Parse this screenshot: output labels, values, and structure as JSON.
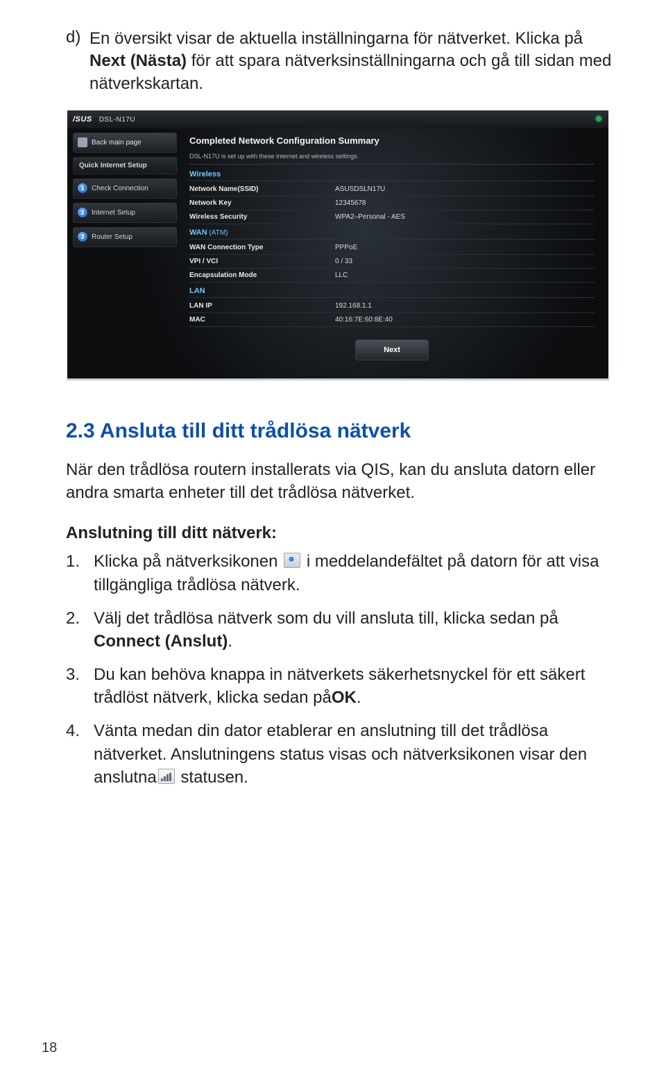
{
  "intro": {
    "marker": "d)",
    "text_pre": "En översikt visar de aktuella inställningarna för nätverket. Klicka på ",
    "text_bold": "Next (Nästa)",
    "text_post": " för att spara nätverksinställningarna och gå till sidan med nätverkskartan."
  },
  "screenshot": {
    "brand": "/SUS",
    "model": "DSL-N17U",
    "sidebar": {
      "back": "Back main page",
      "heading": "Quick Internet Setup",
      "items": [
        {
          "num": "1",
          "label": "Check Connection"
        },
        {
          "num": "2",
          "label": "Internet Setup"
        },
        {
          "num": "3",
          "label": "Router Setup"
        }
      ]
    },
    "main": {
      "title": "Completed Network Configuration Summary",
      "note": "DSL-N17U is set up with these Internet and wireless settings.",
      "sections": [
        {
          "name": "Wireless",
          "annotation": "",
          "rows": [
            {
              "k": "Network Name(SSID)",
              "v": "ASUSDSLN17U"
            },
            {
              "k": "Network Key",
              "v": "12345678"
            },
            {
              "k": "Wireless Security",
              "v": "WPA2–Personal - AES"
            }
          ]
        },
        {
          "name": "WAN",
          "annotation": " (ATM)",
          "rows": [
            {
              "k": "WAN Connection Type",
              "v": "PPPoE"
            },
            {
              "k": "VPI / VCI",
              "v": "0 / 33"
            },
            {
              "k": "Encapsulation Mode",
              "v": "LLC"
            }
          ]
        },
        {
          "name": "LAN",
          "annotation": "",
          "rows": [
            {
              "k": "LAN IP",
              "v": "192.168.1.1"
            },
            {
              "k": "MAC",
              "v": "40:16:7E:60:8E:40"
            }
          ]
        }
      ],
      "next_label": "Next"
    }
  },
  "section": {
    "heading": "2.3  Ansluta till ditt trådlösa nätverk",
    "para": "När den trådlösa routern installerats via QIS, kan du ansluta datorn eller andra smarta enheter till det trådlösa nätverket.",
    "subhead": "Anslutning till ditt nätverk:",
    "steps": {
      "s1_pre": "Klicka på nätverksikonen ",
      "s1_post": " i meddelandefältet på datorn för att visa tillgängliga trådlösa nätverk.",
      "s2_pre": "Välj det trådlösa nätverk som du vill ansluta till, klicka sedan på ",
      "s2_bold": "Connect (Anslut)",
      "s2_post": ".",
      "s3_pre": "Du kan behöva knappa in nätverkets säkerhetsnyckel för ett säkert trådlöst nätverk, klicka sedan på",
      "s3_bold": "OK",
      "s3_post": ".",
      "s4_pre": "Vänta medan din dator etablerar en anslutning till det trådlösa nätverket. Anslutningens status visas och nätverksikonen visar den anslutna",
      "s4_post": " statusen."
    }
  },
  "page_number": "18"
}
